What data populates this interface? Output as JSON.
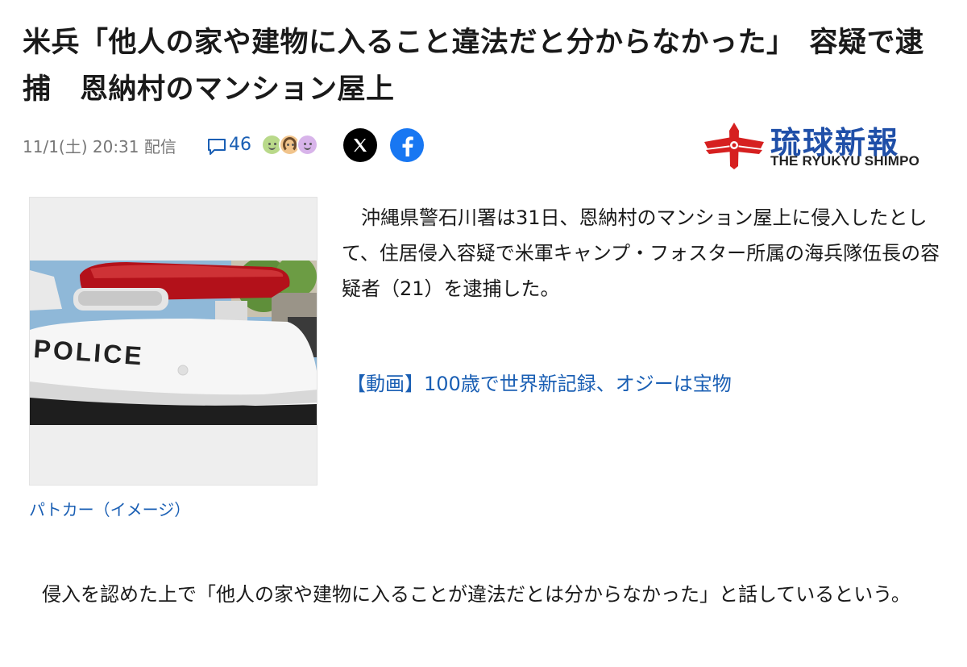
{
  "article": {
    "headline": "米兵「他人の家や建物に入ること違法だと分からなかった」　容疑で逮捕　恩納村のマンション屋上",
    "date": "11/1(土) 20:31 配信",
    "comment_count": "46",
    "publisher": {
      "name_jp": "琉球新報",
      "name_en": "THE RYUKYU SHIMPO"
    },
    "photo_caption": "パトカー（イメージ）",
    "photo_text": "POLICE",
    "lead": "　沖縄県警石川署は31日、恩納村のマンション屋上に侵入したとして、住居侵入容疑で米軍キャンプ・フォスター所属の海兵隊伍長の容疑者（21）を逮捕した。",
    "related_link": "【動画】100歳で世界新記録、オジーは宝物",
    "body": "　侵入を認めた上で「他人の家や建物に入ることが違法だとは分からなかった」と話しているという。"
  },
  "colors": {
    "link": "#1a5fb4",
    "facebook": "#1877f2",
    "publisher_red": "#d62020",
    "publisher_blue": "#1f4fa8"
  },
  "icons": [
    "comment-icon",
    "reaction-icons",
    "x-share-icon",
    "facebook-share-icon",
    "publisher-logo-icon"
  ]
}
